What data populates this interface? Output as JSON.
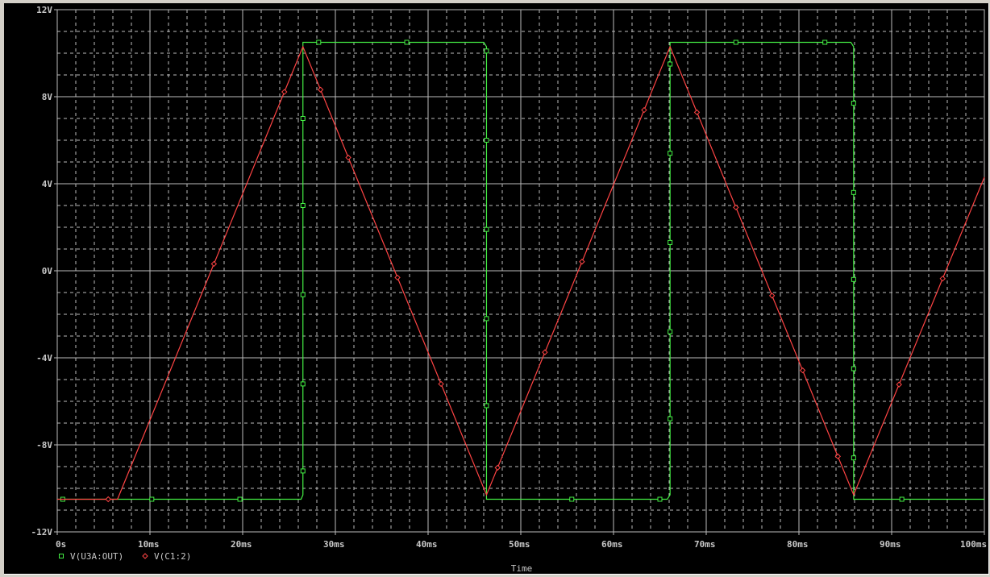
{
  "chart_data": {
    "type": "line",
    "title": "",
    "xlabel": "Time",
    "ylabel": "",
    "xlim": [
      0,
      100
    ],
    "ylim": [
      -12,
      12
    ],
    "x_unit": "ms",
    "grid": true,
    "x_ticks": [
      0,
      10,
      20,
      30,
      40,
      50,
      60,
      70,
      80,
      90,
      100
    ],
    "x_tick_labels": [
      "0s",
      "10ms",
      "20ms",
      "30ms",
      "40ms",
      "50ms",
      "60ms",
      "70ms",
      "80ms",
      "90ms",
      "100ms"
    ],
    "y_ticks": [
      12,
      8,
      4,
      0,
      -4,
      -8,
      -12
    ],
    "y_tick_labels": [
      "12V",
      "8V",
      "4V",
      "0V",
      "-4V",
      "-8V",
      "-12V"
    ],
    "legend_position": "bottom-left",
    "series": [
      {
        "name": "V(U3A:OUT)",
        "color": "#44ee44",
        "marker": "square",
        "x": [
          0,
          26.3,
          26.5,
          26.5,
          46.0,
          46.3,
          46.3,
          65.8,
          66.1,
          66.1,
          85.6,
          85.9,
          85.9,
          100
        ],
        "y": [
          -10.5,
          -10.5,
          -10.3,
          10.5,
          10.5,
          10.3,
          -10.5,
          -10.5,
          -10.3,
          10.5,
          10.5,
          10.3,
          -10.5,
          -10.5
        ],
        "markers": [
          [
            0.6,
            -10.5
          ],
          [
            10.2,
            -10.5
          ],
          [
            19.7,
            -10.5
          ],
          [
            26.5,
            -9.2
          ],
          [
            26.5,
            -5.2
          ],
          [
            26.5,
            -1.1
          ],
          [
            26.5,
            3.0
          ],
          [
            26.5,
            7.0
          ],
          [
            28.2,
            10.5
          ],
          [
            37.7,
            10.5
          ],
          [
            46.3,
            10.1
          ],
          [
            46.3,
            6.0
          ],
          [
            46.3,
            1.9
          ],
          [
            46.3,
            -2.2
          ],
          [
            46.3,
            -6.2
          ],
          [
            55.5,
            -10.5
          ],
          [
            65.0,
            -10.5
          ],
          [
            66.1,
            9.5
          ],
          [
            66.1,
            5.4
          ],
          [
            66.1,
            1.3
          ],
          [
            66.1,
            -2.8
          ],
          [
            66.1,
            -6.8
          ],
          [
            73.2,
            10.5
          ],
          [
            82.8,
            10.5
          ],
          [
            85.9,
            7.7
          ],
          [
            85.9,
            3.6
          ],
          [
            85.9,
            -0.4
          ],
          [
            85.9,
            -4.5
          ],
          [
            85.9,
            -8.6
          ],
          [
            91.1,
            -10.5
          ]
        ]
      },
      {
        "name": "V(C1:2)",
        "color": "#ff4444",
        "marker": "diamond",
        "x": [
          0,
          6.5,
          26.5,
          46.3,
          66.1,
          85.9,
          100
        ],
        "y": [
          -10.5,
          -10.5,
          10.3,
          -10.3,
          10.3,
          -10.3,
          4.3
        ],
        "marker_x": [
          5.5,
          16.9,
          24.5,
          28.4,
          31.4,
          36.7,
          41.4,
          47.5,
          52.6,
          56.6,
          63.3,
          69.0,
          73.2,
          77.1,
          80.4,
          84.2,
          90.8,
          95.5
        ]
      }
    ]
  }
}
